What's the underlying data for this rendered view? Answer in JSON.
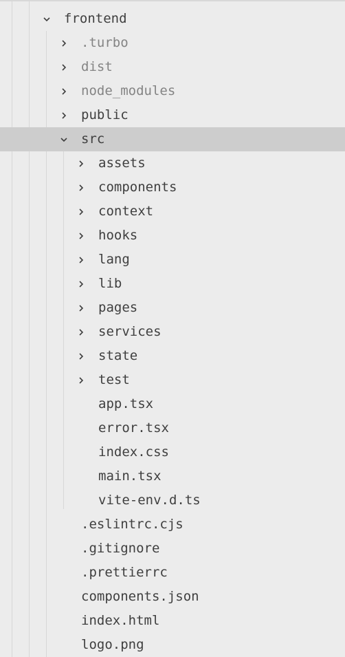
{
  "tree": {
    "root": {
      "label": "frontend",
      "expanded": true
    },
    "level1_folders": [
      {
        "label": ".turbo",
        "expanded": false,
        "dimmed": true
      },
      {
        "label": "dist",
        "expanded": false,
        "dimmed": true
      },
      {
        "label": "node_modules",
        "expanded": false,
        "dimmed": true
      },
      {
        "label": "public",
        "expanded": false,
        "dimmed": false
      }
    ],
    "src": {
      "label": "src",
      "expanded": true,
      "selected": true,
      "folders": [
        {
          "label": "assets"
        },
        {
          "label": "components"
        },
        {
          "label": "context"
        },
        {
          "label": "hooks"
        },
        {
          "label": "lang"
        },
        {
          "label": "lib"
        },
        {
          "label": "pages"
        },
        {
          "label": "services"
        },
        {
          "label": "state"
        },
        {
          "label": "test"
        }
      ],
      "files": [
        {
          "label": "app.tsx"
        },
        {
          "label": "error.tsx"
        },
        {
          "label": "index.css"
        },
        {
          "label": "main.tsx"
        },
        {
          "label": "vite-env.d.ts"
        }
      ]
    },
    "level1_files": [
      {
        "label": ".eslintrc.cjs"
      },
      {
        "label": ".gitignore"
      },
      {
        "label": ".prettierrc"
      },
      {
        "label": "components.json"
      },
      {
        "label": "index.html"
      },
      {
        "label": "logo.png"
      }
    ]
  },
  "colors": {
    "background": "#ececec",
    "selection": "#cdcdcd",
    "text": "#3f3f3f",
    "dimmed_text": "#848484",
    "guide_line": "#d7d7d7"
  }
}
